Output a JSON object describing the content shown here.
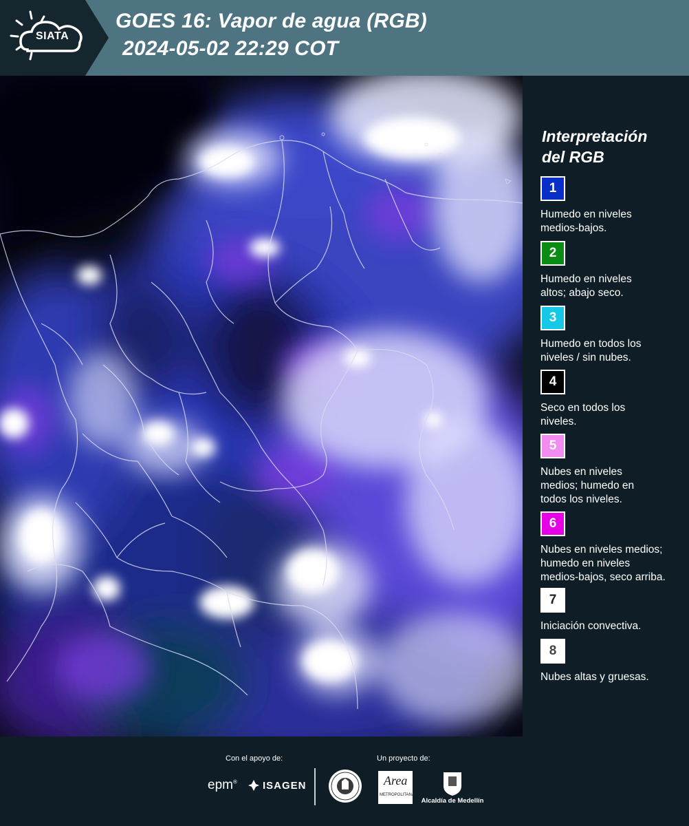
{
  "header": {
    "logo_text": "SIATA",
    "title_line1": "GOES 16: Vapor de agua (RGB)",
    "title_line2": "2024-05-02 22:29 COT"
  },
  "legend": {
    "title_line1": "Interpretación",
    "title_line2": "del RGB",
    "items": [
      {
        "number": "1",
        "color": "#0a2fc8",
        "text_color": "#ffffff",
        "line1": "Humedo en niveles",
        "line2": "medios-bajos.",
        "line3": ""
      },
      {
        "number": "2",
        "color": "#0a8c14",
        "text_color": "#ffffff",
        "line1": "Humedo en niveles",
        "line2": "altos; abajo seco.",
        "line3": ""
      },
      {
        "number": "3",
        "color": "#14c8e6",
        "text_color": "#ffffff",
        "line1": "Humedo en todos los",
        "line2": "niveles / sin nubes.",
        "line3": ""
      },
      {
        "number": "4",
        "color": "#000000",
        "text_color": "#ffffff",
        "line1": "Seco en todos los",
        "line2": "niveles.",
        "line3": ""
      },
      {
        "number": "5",
        "color": "#f28cf0",
        "text_color": "#ffffff",
        "line1": "Nubes en niveles",
        "line2": "medios; humedo en",
        "line3": "todos los niveles."
      },
      {
        "number": "6",
        "color": "#e600e6",
        "text_color": "#ffffff",
        "line1": "Nubes en niveles medios;",
        "line2": "humedo en niveles",
        "line3": "medios-bajos, seco arriba."
      },
      {
        "number": "7",
        "color": "#ffffff",
        "text_color": "#222222",
        "line1": "Iniciación convectiva.",
        "line2": "",
        "line3": ""
      },
      {
        "number": "8",
        "color": "#ffffff",
        "text_color": "#444444",
        "line1": "Nubes altas y gruesas.",
        "line2": "",
        "line3": ""
      }
    ]
  },
  "footer": {
    "support_label": "Con el apoyo de:",
    "project_label": "Un proyecto de:",
    "epm_logo": "epm",
    "isagen_logo": "ISAGEN",
    "amva_logo_text": "Area",
    "amva_logo_caption": "METROPOLITANA",
    "medellin_logo_text": "Alcaldía de Medellín"
  },
  "colors": {
    "header_bg": "#4e7482",
    "panel_bg": "#0f1e26",
    "map_dark": "#06070f",
    "cloud_white": "#eef0ff",
    "moisture_blue": "#3a4bd8",
    "moisture_violet": "#6a3ad0"
  }
}
